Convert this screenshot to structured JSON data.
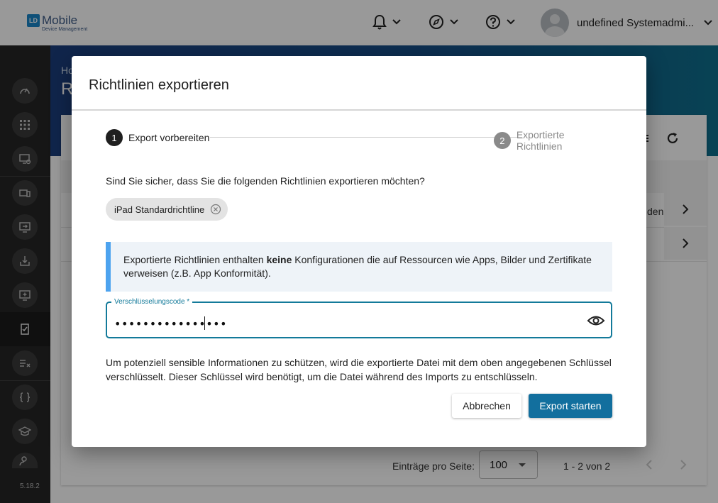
{
  "app": {
    "logo_badge": "LD",
    "logo_main": "Mobile",
    "logo_sub": "Device Management",
    "user_name": "undefined Systemadmi...",
    "version": "5.18.2"
  },
  "header_icons": [
    "bell-icon",
    "compass-icon",
    "help-icon"
  ],
  "background": {
    "breadcrumb": "Ho",
    "title": "R",
    "row_fragment": "den",
    "footer": {
      "entries_label": "Einträge pro Seite:",
      "entries_value": "100",
      "range": "1 - 2 von 2"
    }
  },
  "dialog": {
    "title": "Richtlinien exportieren",
    "steps": [
      {
        "number": "1",
        "label": "Export vorbereiten",
        "state": "active"
      },
      {
        "number": "2",
        "label": "Exportierte Richtlinien",
        "state": "inactive"
      }
    ],
    "question": "Sind Sie sicher, dass Sie die folgenden Richtlinien exportieren möchten?",
    "chip_label": "iPad Standardrichtline",
    "info": {
      "before": "Exportierte Richtlinien enthalten ",
      "emphasis": "keine",
      "after": " Konfigurationen die auf Ressourcen wie Apps, Bilder und Zertifikate verweisen (z.B. App Konformität)."
    },
    "field": {
      "label": "Verschlüsselungscode *",
      "value": "••••••••••••••••"
    },
    "description": "Um potenziell sensible Informationen zu schützen, wird die exportierte Datei mit dem oben angegebenen Schlüssel verschlüsselt. Dieser Schlüssel wird benötigt, um die Datei während des Imports zu entschlüsseln.",
    "cancel_label": "Abbrechen",
    "start_label": "Export starten"
  },
  "colors": {
    "primary": "#126f9e",
    "field_border": "#137a9a",
    "info_accent": "#4da3ef",
    "step_active": "#1f1f1f",
    "step_inactive": "#8a8a8a"
  }
}
